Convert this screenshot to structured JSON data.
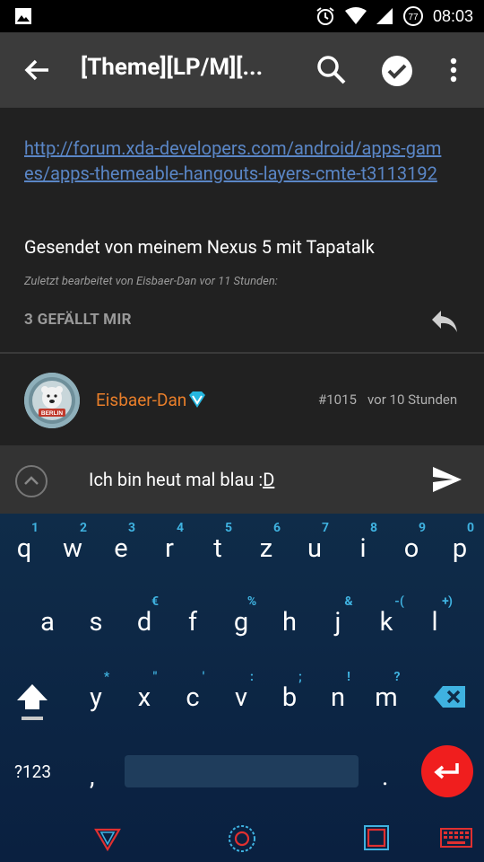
{
  "status_bar": {
    "time": "08:03",
    "battery_level": "77"
  },
  "app_bar": {
    "title": "[Theme][LP/M][..."
  },
  "post": {
    "link": "http://forum.xda-developers.com/android/apps-games/apps-themeable-hangouts-layers-cmte-t3113192",
    "signature": "Gesendet von meinem Nexus 5 mit Tapatalk",
    "edited_note": "Zuletzt bearbeitet von Eisbaer-Dan vor 11 Stunden:",
    "likes": "3 GEFÄLLT MIR"
  },
  "next_post": {
    "username": "Eisbaer-Dan",
    "post_number": "#1015",
    "time": "vor 10 Stunden",
    "avatar_text": "BERLIN"
  },
  "reply_bar": {
    "text_before": "Ich bin heut mal blau :",
    "text_underlined": "D"
  },
  "keyboard": {
    "row1": [
      {
        "ch": "q",
        "hint": "1"
      },
      {
        "ch": "w",
        "hint": "2"
      },
      {
        "ch": "e",
        "hint": "3"
      },
      {
        "ch": "r",
        "hint": "4"
      },
      {
        "ch": "t",
        "hint": "5"
      },
      {
        "ch": "z",
        "hint": "6"
      },
      {
        "ch": "u",
        "hint": "7"
      },
      {
        "ch": "i",
        "hint": "8"
      },
      {
        "ch": "o",
        "hint": "9"
      },
      {
        "ch": "p",
        "hint": "0"
      }
    ],
    "row2": [
      {
        "ch": "a",
        "hint": ""
      },
      {
        "ch": "s",
        "hint": ""
      },
      {
        "ch": "d",
        "hint": "€"
      },
      {
        "ch": "f",
        "hint": ""
      },
      {
        "ch": "g",
        "hint": "%"
      },
      {
        "ch": "h",
        "hint": ""
      },
      {
        "ch": "j",
        "hint": "&"
      },
      {
        "ch": "k",
        "hint": "-"
      },
      {
        "ch": "l",
        "hint": "+"
      }
    ],
    "row2_extra_hints": [
      "(",
      ")"
    ],
    "row3": [
      {
        "ch": "y",
        "hint": "*"
      },
      {
        "ch": "x",
        "hint": "\""
      },
      {
        "ch": "c",
        "hint": "'"
      },
      {
        "ch": "v",
        "hint": ":"
      },
      {
        "ch": "b",
        "hint": ";"
      },
      {
        "ch": "n",
        "hint": "!"
      },
      {
        "ch": "m",
        "hint": "?"
      }
    ],
    "symbols_label": "?123",
    "comma": ",",
    "period": ".",
    "accent_color": "#3fb2e0",
    "enter_color": "#f01e1e"
  },
  "icons": {
    "back": "arrow-left-icon",
    "search": "search-icon",
    "check": "check-circle-icon",
    "more": "more-vert-icon",
    "reply": "reply-icon",
    "send": "send-icon",
    "verified": "verified-badge-icon"
  }
}
